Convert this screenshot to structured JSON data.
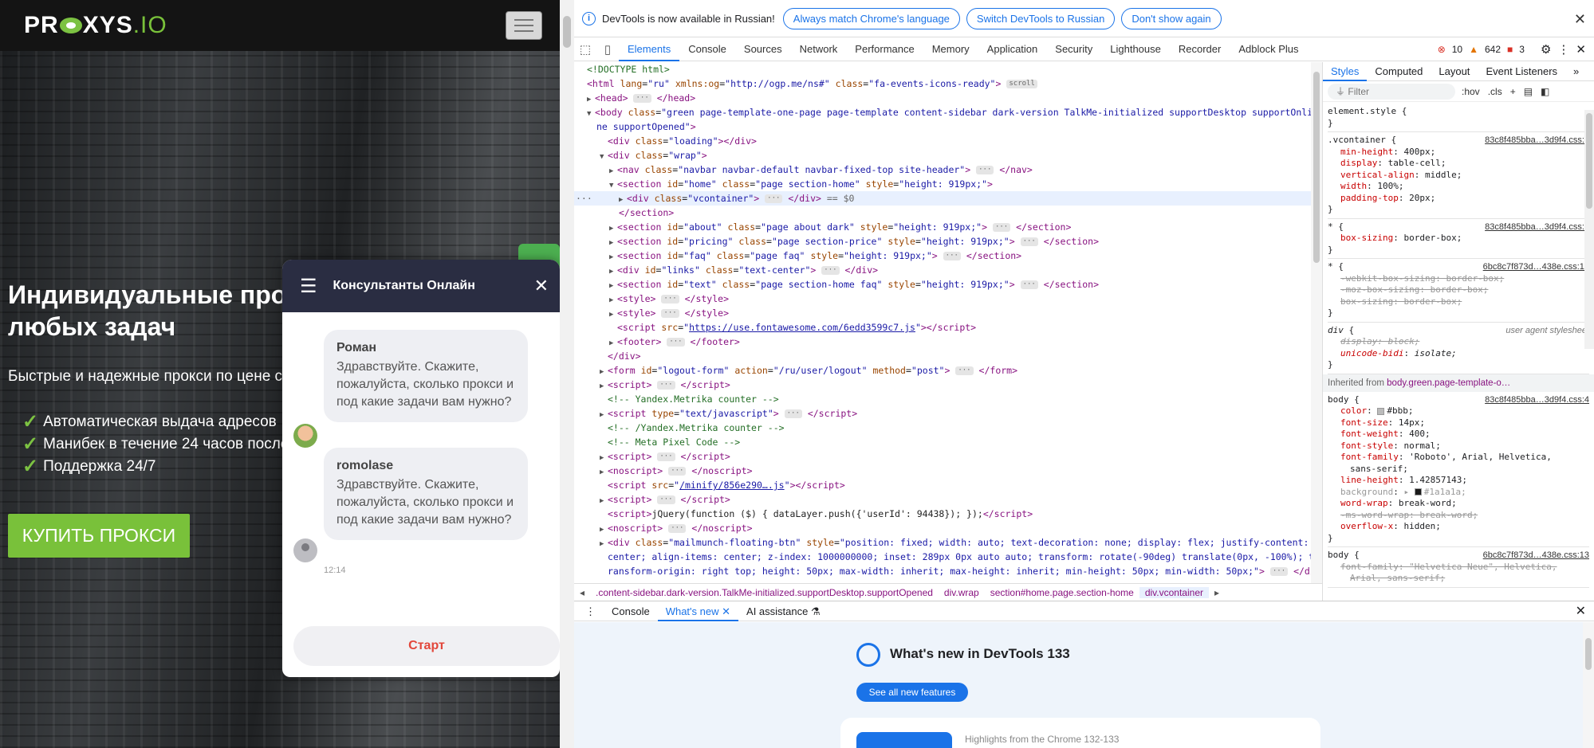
{
  "site": {
    "logo": {
      "part1": "PR",
      "part2": "XYS",
      "part3": ".IO"
    },
    "hero": {
      "title_line1": "Индивидуальные про",
      "title_line2": "любых задач",
      "subtitle": "Быстрые и надежные прокси по цене с",
      "features": [
        "Автоматическая выдача адресов",
        "Манибек в течение 24 часов после",
        "Поддержка 24/7"
      ],
      "buy_button": "КУПИТЬ ПРОКСИ"
    },
    "chat": {
      "title": "Консультанты Онлайн",
      "messages": [
        {
          "name": "Роман",
          "text": "Здравствуйте. Скажите, пожалуйста, сколько прокси и под какие задачи вам нужно?"
        },
        {
          "name": "romolase",
          "text": "Здравствуйте. Скажите, пожалуйста, сколько прокси и под какие задачи вам нужно?"
        }
      ],
      "time": "12:14",
      "start_button": "Старт"
    }
  },
  "devtools": {
    "infobar": {
      "message": "DevTools is now available in Russian!",
      "buttons": [
        "Always match Chrome's language",
        "Switch DevTools to Russian",
        "Don't show again"
      ]
    },
    "tabs": [
      "Elements",
      "Console",
      "Sources",
      "Network",
      "Performance",
      "Memory",
      "Application",
      "Security",
      "Lighthouse",
      "Recorder",
      "Adblock Plus"
    ],
    "active_tab": "Elements",
    "counts": {
      "errors": "10",
      "warnings": "642",
      "issues": "3"
    },
    "breadcrumbs": [
      ".content-sidebar.dark-version.TalkMe-initialized.supportDesktop.supportOpened",
      "div.wrap",
      "section#home.page.section-home",
      "div.vcontainer"
    ],
    "styles_tabs": [
      "Styles",
      "Computed",
      "Layout",
      "Event Listeners"
    ],
    "styles_filter_placeholder": "Filter",
    "styles_tools": [
      ":hov",
      ".cls"
    ],
    "inherited_label": "Inherited from",
    "inherited_from": "body.green.page-template-o…",
    "drawer_tabs": [
      "Console",
      "What's new",
      "AI assistance"
    ],
    "whats_new": {
      "title": "What's new in DevTools 133",
      "button": "See all new features",
      "card_caption": "Highlights from the Chrome 132-133"
    }
  }
}
